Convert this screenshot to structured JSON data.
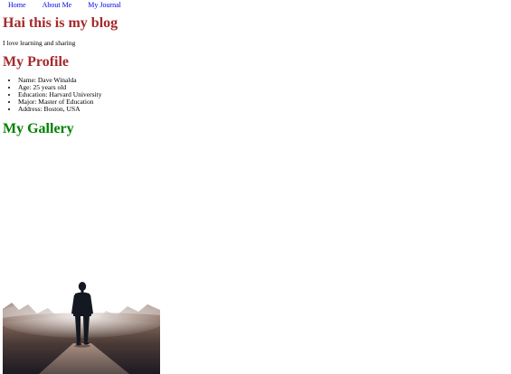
{
  "nav": {
    "items": [
      "Home",
      "About Me",
      "My Journal"
    ]
  },
  "header": {
    "title": "Hai this is my blog",
    "tagline": "I love learning and sharing"
  },
  "profile": {
    "heading": "My Profile",
    "items": [
      "Name: Dave Winalda",
      "Age: 25 years old",
      "Education: Harvard University",
      "Major: Master of Education",
      "Address: Boston, USA"
    ]
  },
  "gallery": {
    "heading": "My Gallery",
    "photo_subject": "person-walking-on-road-photo"
  },
  "colors": {
    "heading_red": "#a52a2a",
    "heading_green": "#008000",
    "link_blue": "#0000ee"
  }
}
